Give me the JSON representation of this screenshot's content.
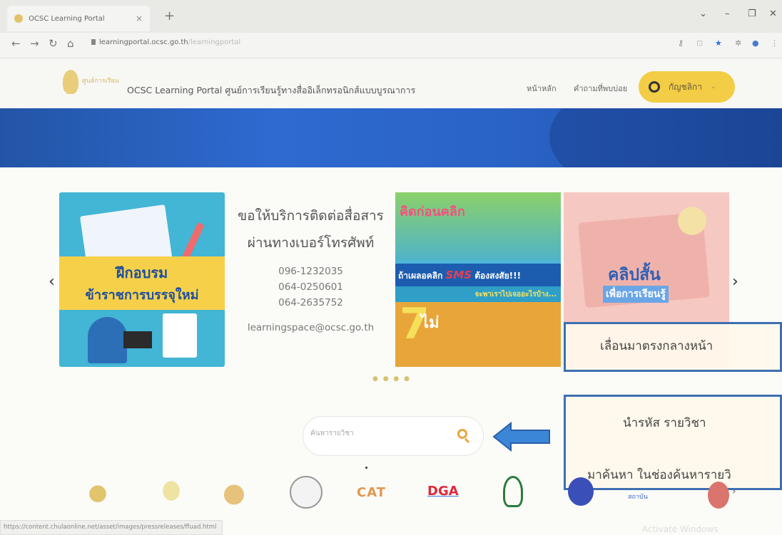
{
  "browser": {
    "tab_title": "OCSC Learning Portal",
    "tab_close": "×",
    "new_tab": "+",
    "url_host": "learningportal.ocsc.go.th",
    "url_path": "/learningportal",
    "status_url": "https://content.chulaonline.net/asset/images/pressreleases/ffuad.html"
  },
  "header": {
    "logo_text": "ศูนย์การเรียน",
    "site_title": "OCSC Learning Portal ศูนย์การเรียนรู้ทางสื่ออิเล็กทรอนิกส์แบบบูรณาการ",
    "nav_home": "หน้าหลัก",
    "nav_faq": "คำถามที่พบบ่อย",
    "account_label": "กัญชลิกา"
  },
  "carousel": {
    "prev": "‹",
    "next": "›",
    "slide1": {
      "line1": "ฝึกอบรม",
      "line2": "ข้าราชการบรรจุใหม่"
    },
    "slide2": {
      "line1": "ขอให้บริการติดต่อสื่อสาร",
      "line2": "ผ่านทางเบอร์โทรศัพท์",
      "phones": [
        "096-1232035",
        "064-0250601",
        "064-2635752"
      ],
      "email": "learningspace@ocsc.go.th"
    },
    "slide3": {
      "heading": "คิดก่อนคลิก",
      "sms_pre": "ถ้าเผลอคลิก ",
      "sms": "SMS",
      "sms_post": " ต้องสงสัย!!!",
      "sub": "จะพาเราไปเจออะไรบ้าง...",
      "seven": "7",
      "mai": "ไม่"
    },
    "slide4": {
      "line1": "คลิปสั้น",
      "line2": "เพื่อการเรียนรู้"
    },
    "dots": "● ● ● ●"
  },
  "search": {
    "placeholder": "ค้นหารายวิชา"
  },
  "callouts": {
    "c1": "เลื่อนมาตรงกลางหน้า",
    "c2_line1": "นำรหัส รายวิชา",
    "c2_line2": "มาค้นหา ในช่องค้นหารายวิ"
  },
  "partners": {
    "cat": "CAT",
    "dga": "DGA",
    "p9": "สถาบัน"
  },
  "watermark": "Activate Windows"
}
